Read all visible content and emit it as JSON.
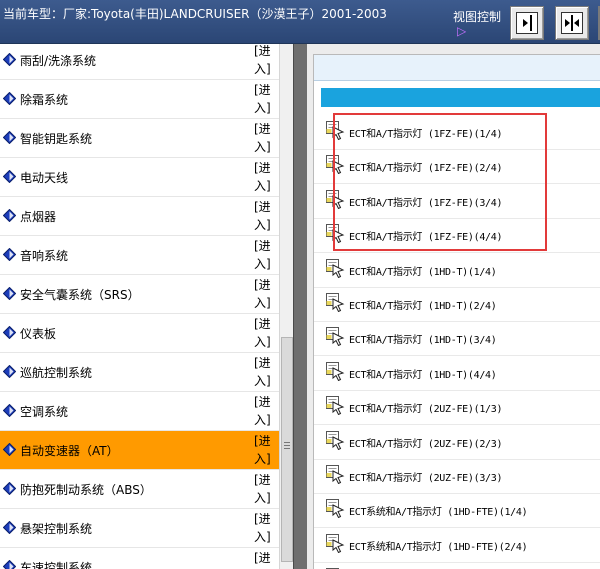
{
  "header": {
    "title": "当前车型：厂家:Toyota(丰田)LANDCRUISER（沙漠王子）2001-2003",
    "view_control_label": "视图控制",
    "view_arrow_glyph": "▷"
  },
  "sidebar": {
    "enter_label": "[进入]",
    "items": [
      {
        "label": "雨刮/洗涤系统",
        "selected": false
      },
      {
        "label": "除霜系统",
        "selected": false
      },
      {
        "label": "智能钥匙系统",
        "selected": false
      },
      {
        "label": "电动天线",
        "selected": false
      },
      {
        "label": "点烟器",
        "selected": false
      },
      {
        "label": "音响系统",
        "selected": false
      },
      {
        "label": "安全气囊系统（SRS）",
        "selected": false
      },
      {
        "label": "仪表板",
        "selected": false
      },
      {
        "label": "巡航控制系统",
        "selected": false
      },
      {
        "label": "空调系统",
        "selected": false
      },
      {
        "label": "自动变速器（AT）",
        "selected": true
      },
      {
        "label": "防抱死制动系统（ABS）",
        "selected": false
      },
      {
        "label": "悬架控制系统",
        "selected": false
      },
      {
        "label": "车速控制系统",
        "selected": false
      }
    ]
  },
  "documents": {
    "items": [
      "ECT和A/T指示灯 (1FZ-FE)(1/4)",
      "ECT和A/T指示灯 (1FZ-FE)(2/4)",
      "ECT和A/T指示灯 (1FZ-FE)(3/4)",
      "ECT和A/T指示灯 (1FZ-FE)(4/4)",
      "ECT和A/T指示灯 (1HD-T)(1/4)",
      "ECT和A/T指示灯 (1HD-T)(2/4)",
      "ECT和A/T指示灯 (1HD-T)(3/4)",
      "ECT和A/T指示灯 (1HD-T)(4/4)",
      "ECT和A/T指示灯 (2UZ-FE)(1/3)",
      "ECT和A/T指示灯 (2UZ-FE)(2/3)",
      "ECT和A/T指示灯 (2UZ-FE)(3/3)",
      "ECT系统和A/T指示灯 (1HD-FTE)(1/4)",
      "ECT系统和A/T指示灯 (1HD-FTE)(2/4)",
      ""
    ]
  },
  "colors": {
    "selected_row": "#ff9a00",
    "highlight_border": "#e23a3a",
    "blue_band": "#1aa3de",
    "header_bg": "#2b4675"
  }
}
